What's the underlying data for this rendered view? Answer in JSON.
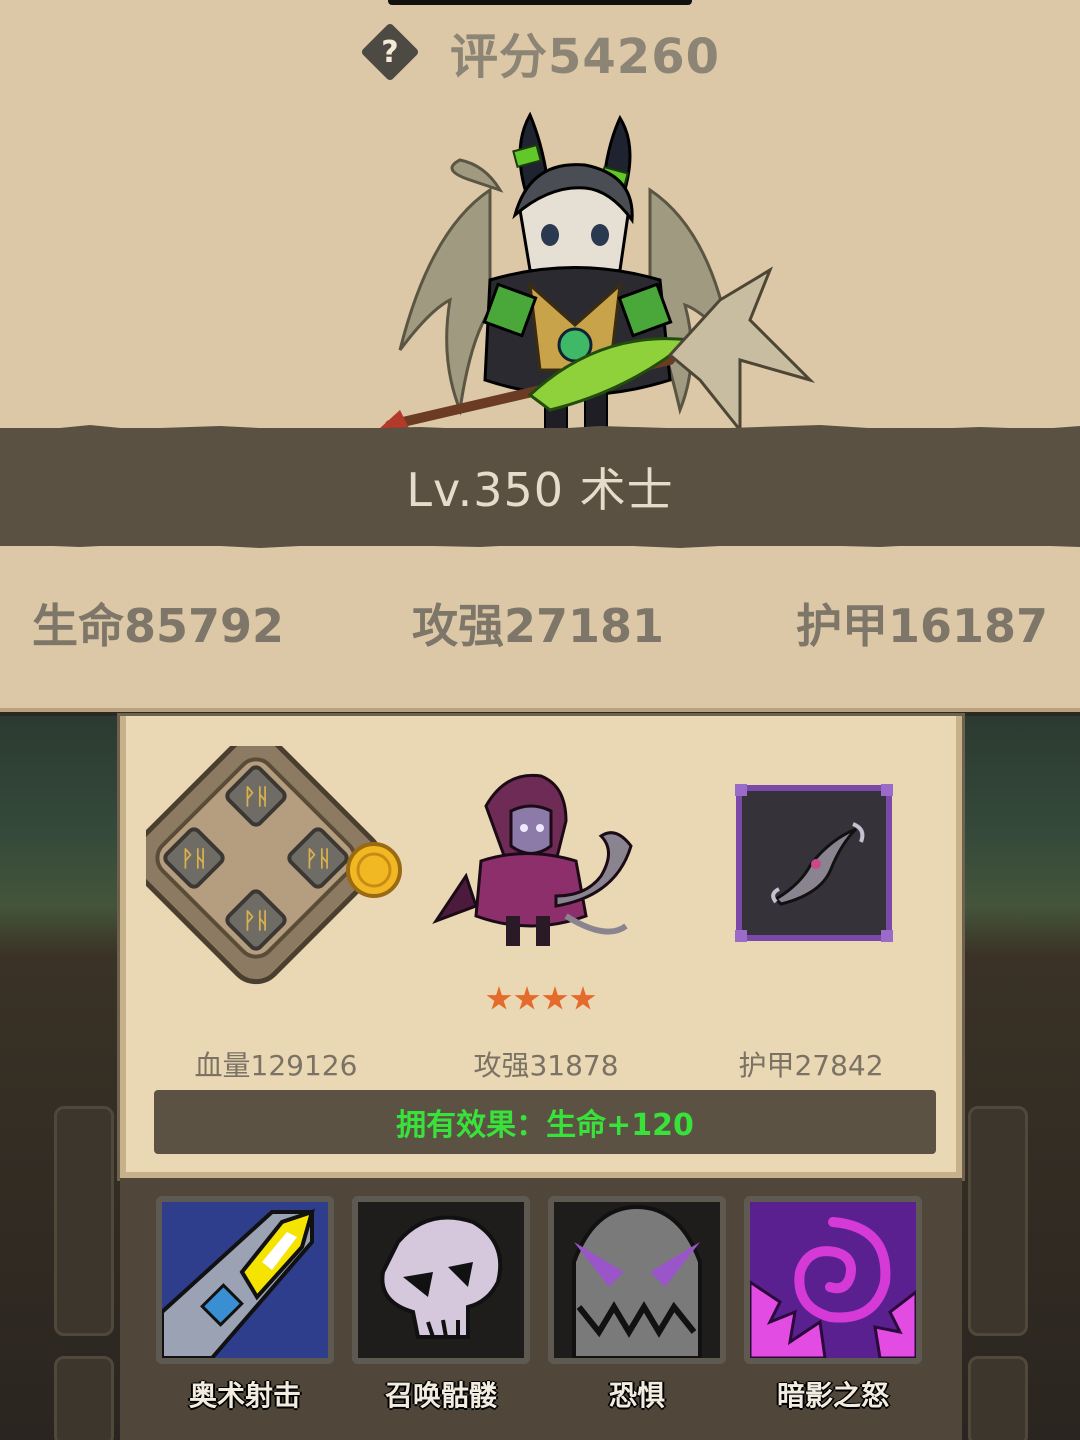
{
  "header": {
    "help_icon": "question-mark-icon",
    "help_symbol": "?",
    "score": "评分54260"
  },
  "hero": {
    "level_class": "Lv.350 术士",
    "stats": {
      "hp": "生命85792",
      "attack": "攻强27181",
      "armor": "护甲16187"
    }
  },
  "cards": {
    "items": [
      {
        "icon": "rune-stone-icon",
        "label": "血量129126"
      },
      {
        "icon": "dark-ranger-companion",
        "label": "攻强31878",
        "stars": 4
      },
      {
        "icon": "dark-bow-icon",
        "label": "护甲27842"
      }
    ],
    "effect": "拥有效果：生命+120"
  },
  "skills": [
    {
      "icon": "arcane-shot-icon",
      "name": "奥术射击"
    },
    {
      "icon": "summon-skeleton-icon",
      "name": "召唤骷髅"
    },
    {
      "icon": "fear-icon",
      "name": "恐惧"
    },
    {
      "icon": "shadow-wrath-icon",
      "name": "暗影之怒"
    }
  ],
  "colors": {
    "parchment": "#dcc8a6",
    "band": "#5a5143",
    "effect_green": "#38e23a",
    "star_orange": "#e46b2c"
  }
}
